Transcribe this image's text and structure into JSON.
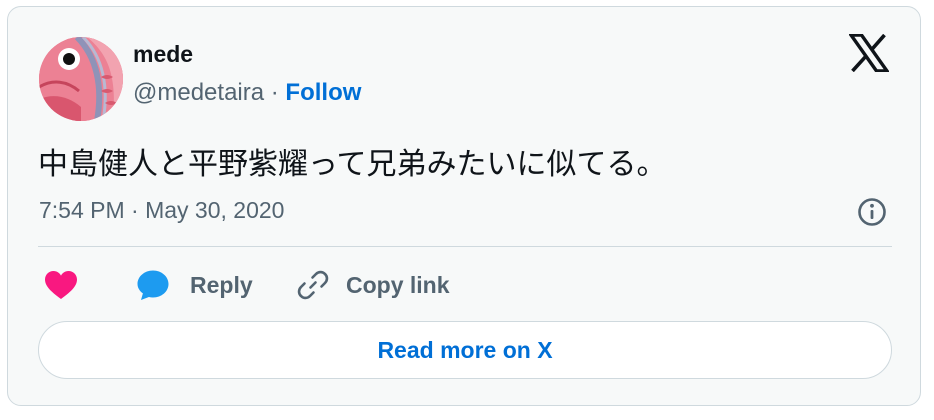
{
  "author": {
    "name": "mede",
    "handle": "@medetaira",
    "separator": " · ",
    "follow_label": "Follow",
    "avatar_icon": "red-fish-avatar"
  },
  "logo_icon": "x-logo-icon",
  "tweet": {
    "text": "中島健人と平野紫耀って兄弟みたいに似てる。",
    "timestamp": "7:54 PM · May 30, 2020"
  },
  "actions": {
    "like_icon": "heart-icon",
    "reply_icon": "reply-bubble-icon",
    "reply_label": "Reply",
    "copy_icon": "link-icon",
    "copy_label": "Copy link"
  },
  "read_more_label": "Read more on X",
  "colors": {
    "link_blue": "#006fd6",
    "heart_pink": "#f91880",
    "reply_blue": "#1d9bf0",
    "secondary_text": "#536471",
    "border": "#cfd9de",
    "card_bg": "#f7f9f9"
  }
}
